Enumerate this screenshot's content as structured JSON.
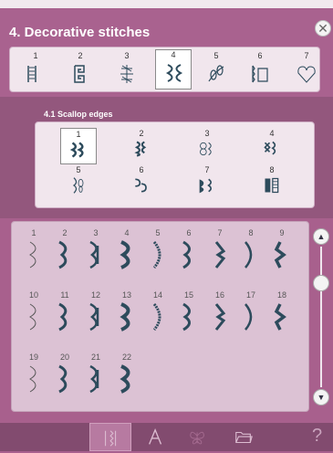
{
  "window": {
    "title": "4. Decorative stitches",
    "close_icon": "close-icon"
  },
  "categories": [
    {
      "num": "1",
      "icon": "satin-stitch-icon"
    },
    {
      "num": "2",
      "icon": "greek-key-stitch-icon"
    },
    {
      "num": "3",
      "icon": "floral-stitch-icon"
    },
    {
      "num": "4",
      "icon": "scallop-stitch-icon",
      "selected": true
    },
    {
      "num": "5",
      "icon": "leaf-stitch-icon"
    },
    {
      "num": "6",
      "icon": "border-stitch-icon"
    },
    {
      "num": "7",
      "icon": "heart-stitch-icon"
    }
  ],
  "subcategory": {
    "title": "4.1 Scallop edges",
    "items": [
      {
        "num": "1",
        "icon": "scallop-edge-icon",
        "selected": true
      },
      {
        "num": "2",
        "icon": "double-scallop-icon"
      },
      {
        "num": "3",
        "icon": "ornamental-scallop-icon"
      },
      {
        "num": "4",
        "icon": "heirloom-scallop-icon"
      },
      {
        "num": "5",
        "icon": "vine-scallop-icon"
      },
      {
        "num": "6",
        "icon": "curl-scallop-icon"
      },
      {
        "num": "7",
        "icon": "filled-scallop-icon"
      },
      {
        "num": "8",
        "icon": "block-scallop-icon"
      }
    ]
  },
  "stitches": [
    {
      "num": "1"
    },
    {
      "num": "2"
    },
    {
      "num": "3"
    },
    {
      "num": "4"
    },
    {
      "num": "5"
    },
    {
      "num": "6"
    },
    {
      "num": "7"
    },
    {
      "num": "8"
    },
    {
      "num": "9"
    },
    {
      "num": "10"
    },
    {
      "num": "11"
    },
    {
      "num": "12"
    },
    {
      "num": "13"
    },
    {
      "num": "14"
    },
    {
      "num": "15"
    },
    {
      "num": "16"
    },
    {
      "num": "17"
    },
    {
      "num": "18"
    },
    {
      "num": "19"
    },
    {
      "num": "20"
    },
    {
      "num": "21"
    },
    {
      "num": "22"
    }
  ],
  "scrollbar": {
    "up_icon": "chevron-up-icon",
    "down_icon": "chevron-down-icon",
    "position": 0.2
  },
  "footer": {
    "items": [
      {
        "icon": "stitch-menu-icon",
        "selected": true
      },
      {
        "icon": "font-menu-icon"
      },
      {
        "icon": "butterfly-embroidery-icon",
        "disabled": true
      },
      {
        "icon": "folder-icon"
      }
    ],
    "help": "?"
  },
  "colors": {
    "background": "#a85f8e",
    "mid_band": "#93577d",
    "panel": "#f1e6ed",
    "grid_panel": "#dcc2d4",
    "stitch": "#2d4b5c",
    "footer": "#824b6f"
  }
}
